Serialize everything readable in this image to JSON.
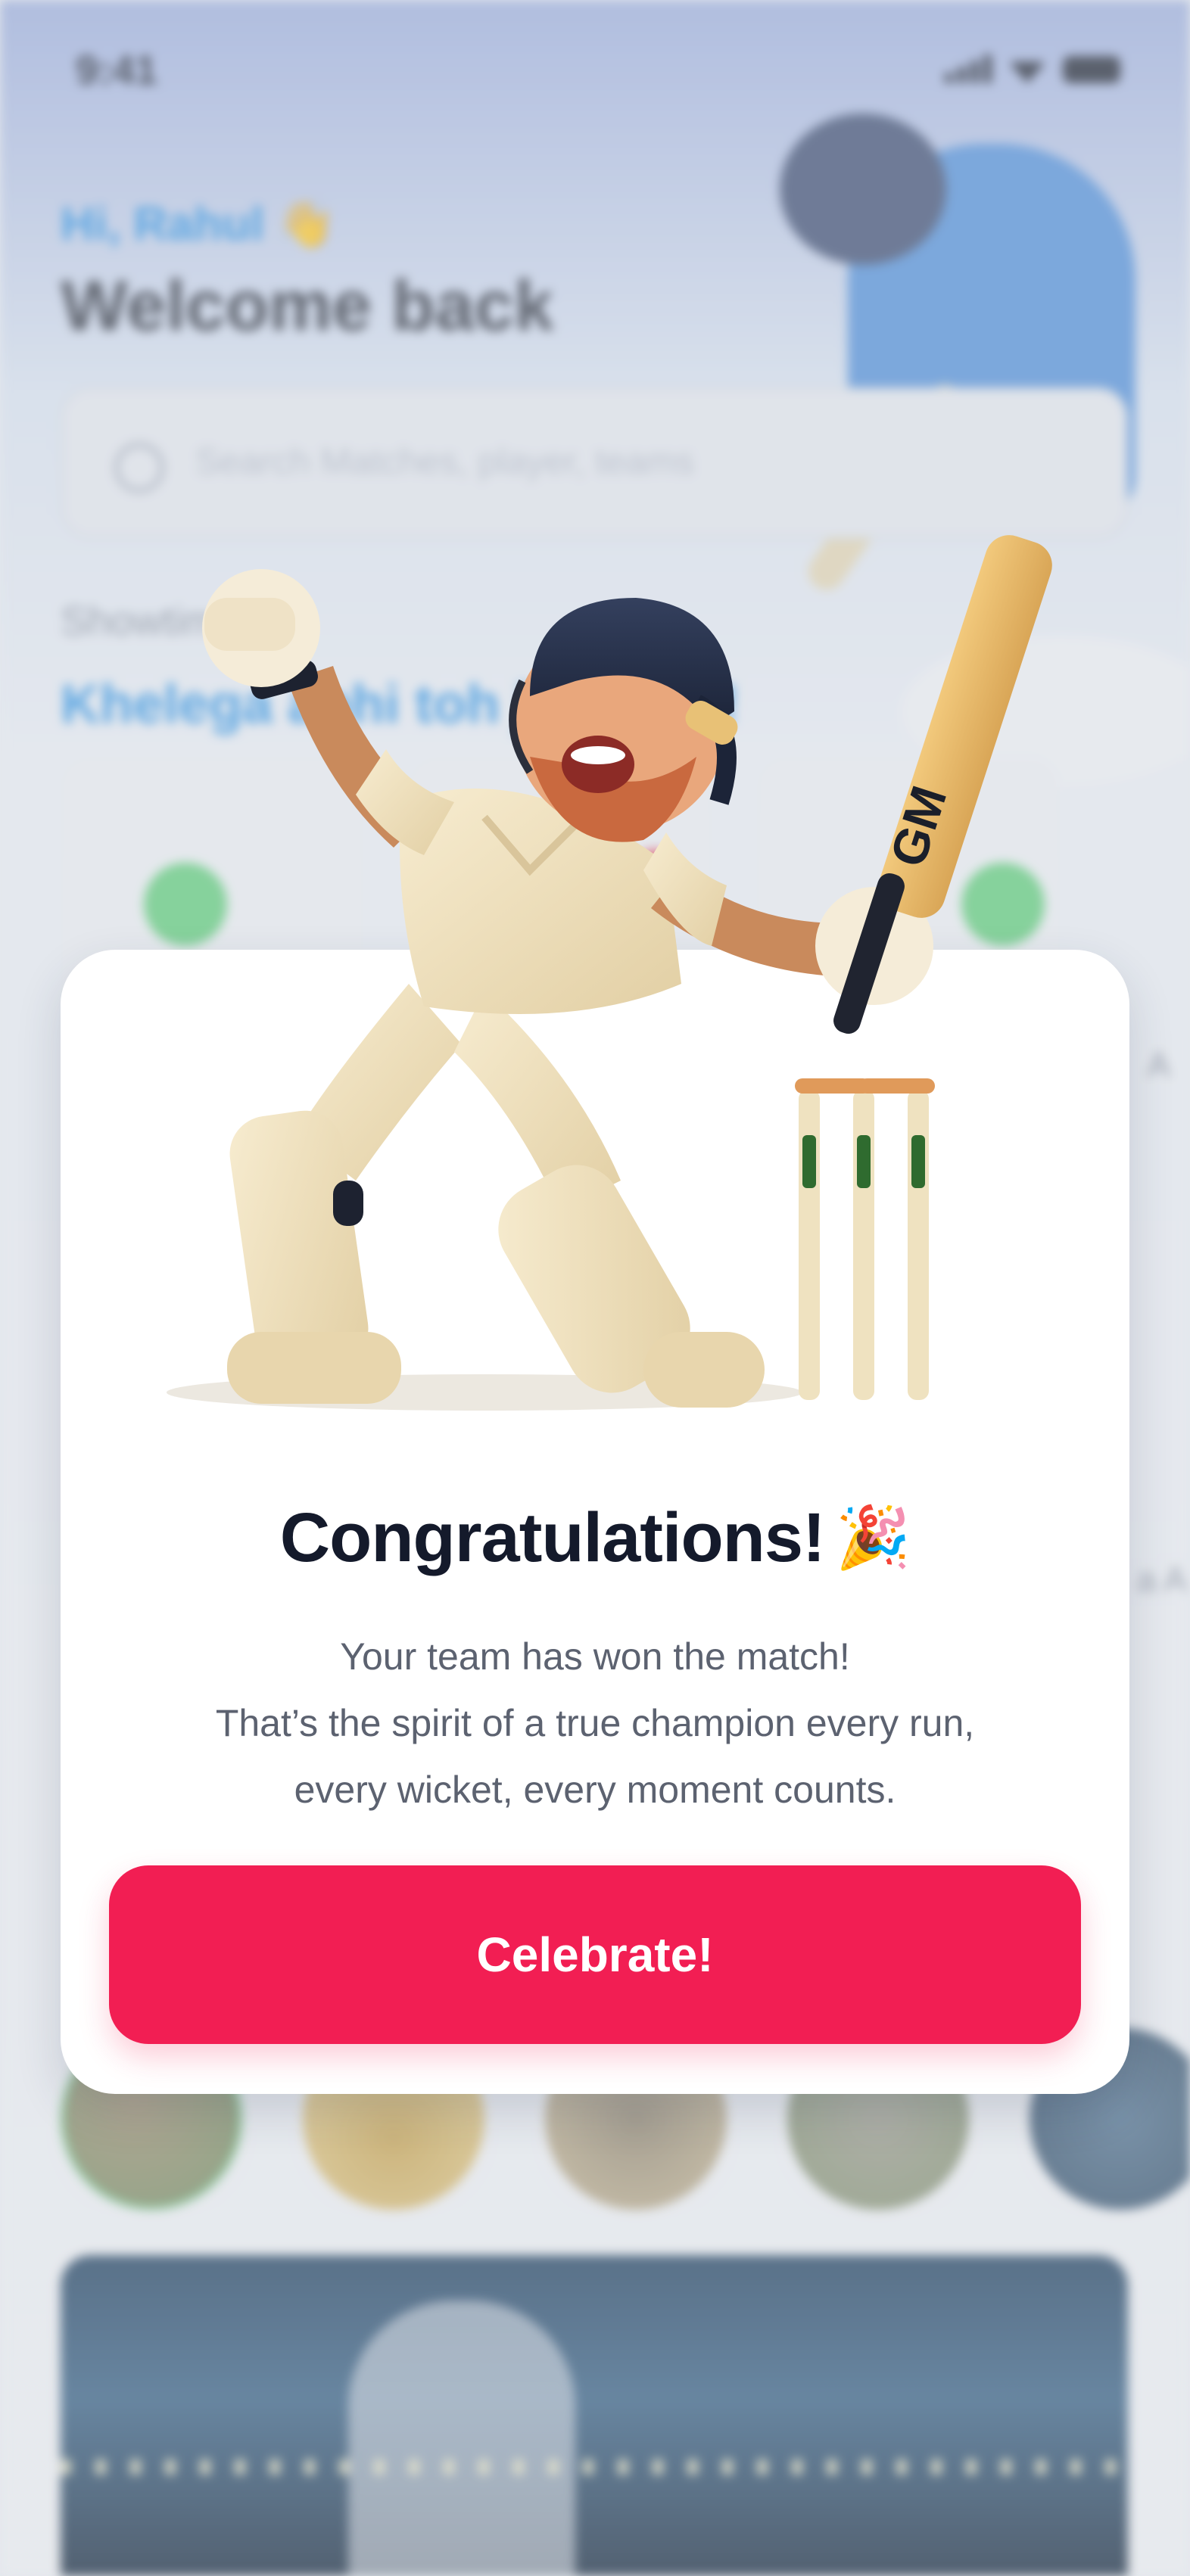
{
  "status_bar": {
    "time": "9:41"
  },
  "home": {
    "greeting": "Hi, Rahul 👋",
    "welcome": "Welcome back",
    "search": {
      "placeholder": "Search Matches, player, teams"
    },
    "section_subtitle": "Showtime",
    "section_title": "Khelega abhi toh jeetega!!",
    "side_notes": [
      "A",
      "a A"
    ]
  },
  "modal": {
    "title": "Congratulations!",
    "title_icon": "party-popper-icon",
    "message_lines": [
      "Your team has won the match!",
      "That’s the spirit of a true champion every run,",
      "every wicket, every moment counts."
    ],
    "button_label": "Celebrate!",
    "illustration": {
      "bat_brand": "GM",
      "icon": "cricket-player-celebrating-icon"
    }
  },
  "colors": {
    "accent": "#f21e53",
    "title": "#141a2b",
    "body_text": "#5c6270",
    "brand_blue": "#2690e6",
    "team_green": "#5fcf7a"
  }
}
